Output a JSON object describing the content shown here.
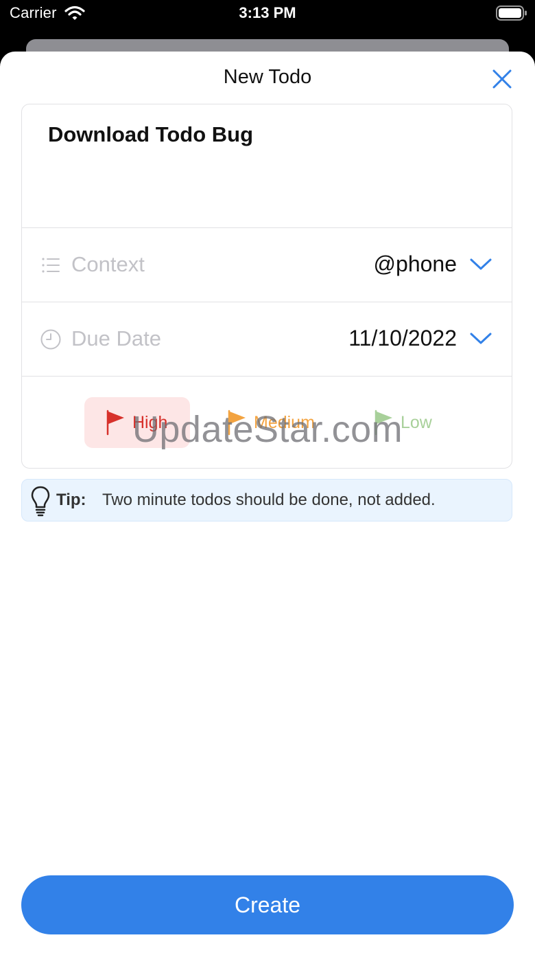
{
  "status_bar": {
    "carrier": "Carrier",
    "time": "3:13 PM"
  },
  "sheet": {
    "title": "New Todo"
  },
  "todo": {
    "title": "Download Todo Bug"
  },
  "context": {
    "label": "Context",
    "value": "@phone"
  },
  "due_date": {
    "label": "Due Date",
    "value": "11/10/2022"
  },
  "priority": {
    "high": "High",
    "medium": "Medium",
    "low": "Low",
    "selected": "High"
  },
  "tip": {
    "label": "Tip:",
    "text": "Two minute todos should be done, not added."
  },
  "watermark": "UpdateStar.com",
  "create_button": "Create",
  "colors": {
    "accent": "#3281e8",
    "high": "#d7312b",
    "medium": "#f3a340",
    "low": "#a8d09a"
  },
  "icons": [
    "wifi-icon",
    "battery-icon",
    "close-icon",
    "list-icon",
    "clock-icon",
    "chevron-down-icon",
    "flag-icon",
    "lightbulb-icon"
  ]
}
